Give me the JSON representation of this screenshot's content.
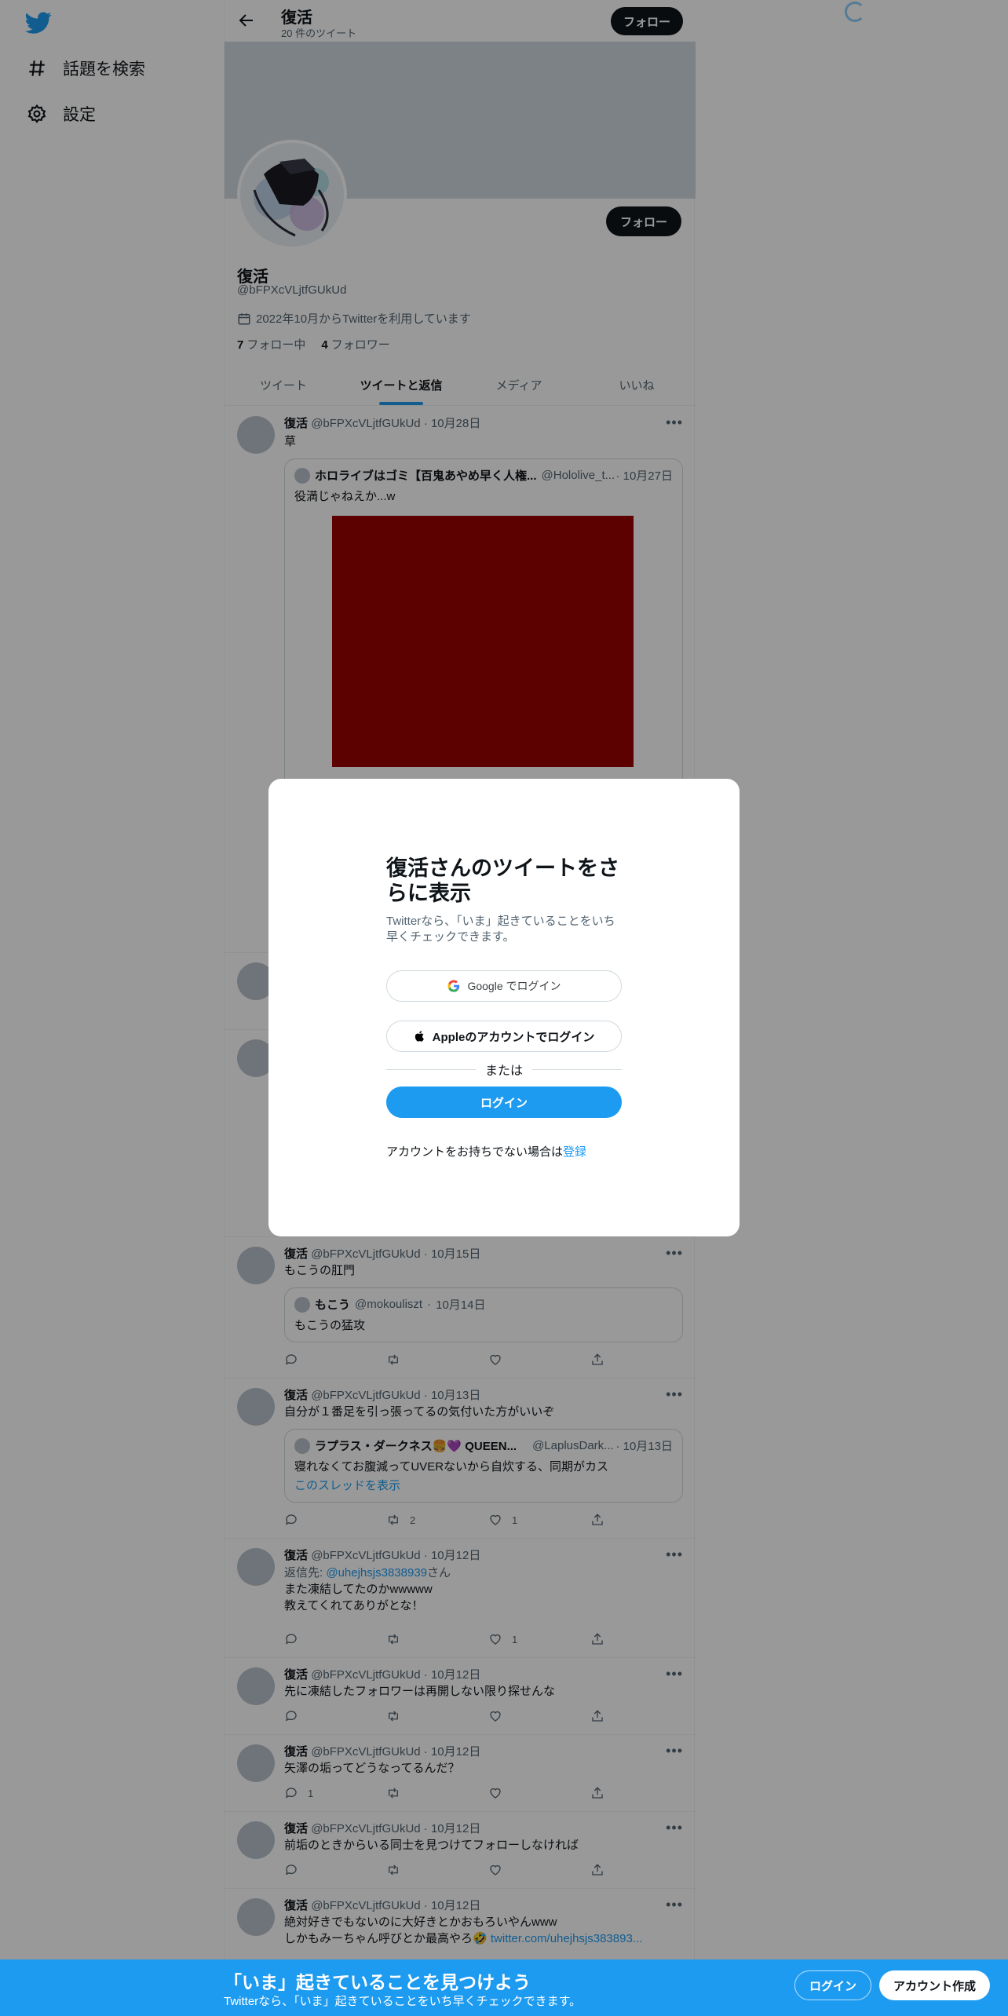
{
  "nav": {
    "explore_label": "話題を検索",
    "settings_label": "設定"
  },
  "header": {
    "title": "復活",
    "subtitle": "20 件のツイート",
    "follow_label": "フォロー"
  },
  "profile": {
    "name": "復活",
    "handle": "@bFPXcVLjtfGUkUd",
    "joined": "2022年10月からTwitterを利用しています",
    "following_count": "7",
    "following_label": "フォロー中",
    "followers_count": "4",
    "followers_label": "フォロワー",
    "follow_label": "フォロー"
  },
  "tabs": [
    "ツイート",
    "ツイートと返信",
    "メディア",
    "いいね"
  ],
  "tweets": [
    {
      "name": "復活",
      "handle": "@bFPXcVLjtfGUkUd",
      "date": "10月28日",
      "text": "草",
      "quote": {
        "name": "ホロライブはゴミ【百鬼あやめ早く人権...",
        "handle": "@Hololive_t...",
        "date": "10月27日",
        "text": "役満じゃねえか...w"
      }
    },
    {
      "name": "復活",
      "handle": "@bFPXcVLjtfGUkUd",
      "date": "10月15日",
      "text": "もこうの肛門",
      "quote": {
        "name": "もこう",
        "handle": "@mokouliszt",
        "date": "10月14日",
        "text": "もこうの猛攻"
      }
    },
    {
      "name": "復活",
      "handle": "@bFPXcVLjtfGUkUd",
      "date": "10月13日",
      "text": "自分が１番足を引っ張ってるの気付いた方がいいぞ",
      "quote": {
        "name": "ラプラス・ダークネス🍔💜 QUEEN...",
        "handle": "@LaplusDark...",
        "date": "10月13日",
        "text": "寝れなくてお腹減ってUVERないから自炊する、同期がカス",
        "link": "このスレッドを表示"
      },
      "retweets": "2",
      "likes": "1"
    },
    {
      "name": "復活",
      "handle": "@bFPXcVLjtfGUkUd",
      "date": "10月12日",
      "reply_prefix": "返信先: ",
      "reply_to": "@uhejhsjs3838939",
      "reply_suffix": "さん",
      "text": "また凍結してたのかwwwww\n教えてくれてありがとな！",
      "likes": "1"
    },
    {
      "name": "復活",
      "handle": "@bFPXcVLjtfGUkUd",
      "date": "10月12日",
      "text": "先に凍結したフォロワーは再開しない限り探せんな"
    },
    {
      "name": "復活",
      "handle": "@bFPXcVLjtfGUkUd",
      "date": "10月12日",
      "text": "矢澤の垢ってどうなってるんだ？",
      "replies": "1"
    },
    {
      "name": "復活",
      "handle": "@bFPXcVLjtfGUkUd",
      "date": "10月12日",
      "text": "前垢のときからいる同士を見つけてフォローしなければ"
    },
    {
      "name": "復活",
      "handle": "@bFPXcVLjtfGUkUd",
      "date": "10月12日",
      "text": "絶対好きでもないのに大好きとかおもろいやんwww",
      "text2": "しかもみーちゃん呼びとか最高やろ🤣 ",
      "link": "twitter.com/uhejhsjs383893..."
    }
  ],
  "modal": {
    "title": "復活さんのツイートをさらに表示",
    "subtitle": "Twitterなら、「いま」起きていることをいち早くチェックできます。",
    "google_label": "Google でログイン",
    "apple_label": "Appleのアカウントでログイン",
    "or_label": "または",
    "login_label": "ログイン",
    "signup_prompt": "アカウントをお持ちでない場合は",
    "signup_link": "登録"
  },
  "bottombar": {
    "title": "「いま」起きていることを見つけよう",
    "subtitle": "Twitterなら、「いま」起きていることをいち早くチェックできます。",
    "login_label": "ログイン",
    "signup_label": "アカウント作成"
  },
  "colors": {
    "accent": "#1d9bf0",
    "quote_image": "#990000",
    "banner": "#cfd9de"
  }
}
